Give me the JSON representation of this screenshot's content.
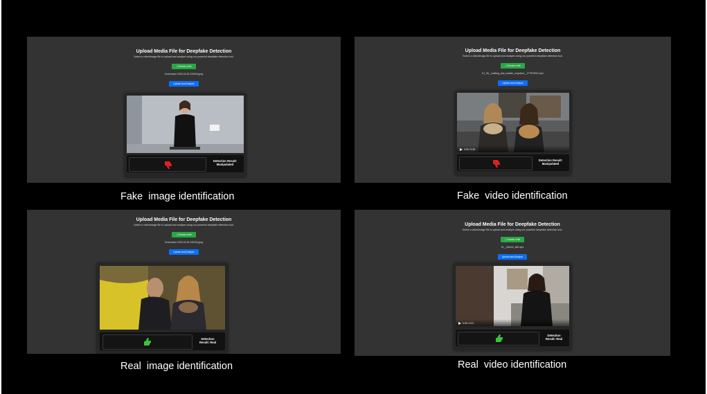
{
  "app": {
    "heading": "Upload Media File for Deepfake Detection",
    "description": "Select a video/image file to upload and analyze using our powerful deepfake detection tool.",
    "choose_label": "Choose a file",
    "upload_label": "Upload and Analyze"
  },
  "panels": [
    {
      "filename": "Screenshot 2025-03-26 233000.jpeg",
      "verdict_icon": "thumbs-down-icon",
      "verdict_color": "#e02020",
      "result_line1": "Detection Result:",
      "result_line2": "Manipulated",
      "caption": "Fake  image identification"
    },
    {
      "filename": "01_05__walking_and_outside_surprised__ITTRHD9Z.mp4",
      "time": "0:00 / 0:25",
      "verdict_icon": "thumbs-down-icon",
      "verdict_color": "#e02020",
      "result_line1": "Detection Result:",
      "result_line2": "Manipulated",
      "caption": "Fake  video identification"
    },
    {
      "filename": "Screenshot 2025-03-26 230032.jpeg",
      "verdict_icon": "thumbs-up-icon",
      "verdict_color": "#3ac43a",
      "result_line1": "Detection",
      "result_line2": "Result: Real",
      "caption": "Real  image identification"
    },
    {
      "filename": "01__kitchen_still.mp4",
      "time": "0:00 / 0:21",
      "verdict_icon": "thumbs-up-icon",
      "verdict_color": "#3ac43a",
      "result_line1": "Detection",
      "result_line2": "Result: Real",
      "caption": "Real  video identification"
    }
  ]
}
